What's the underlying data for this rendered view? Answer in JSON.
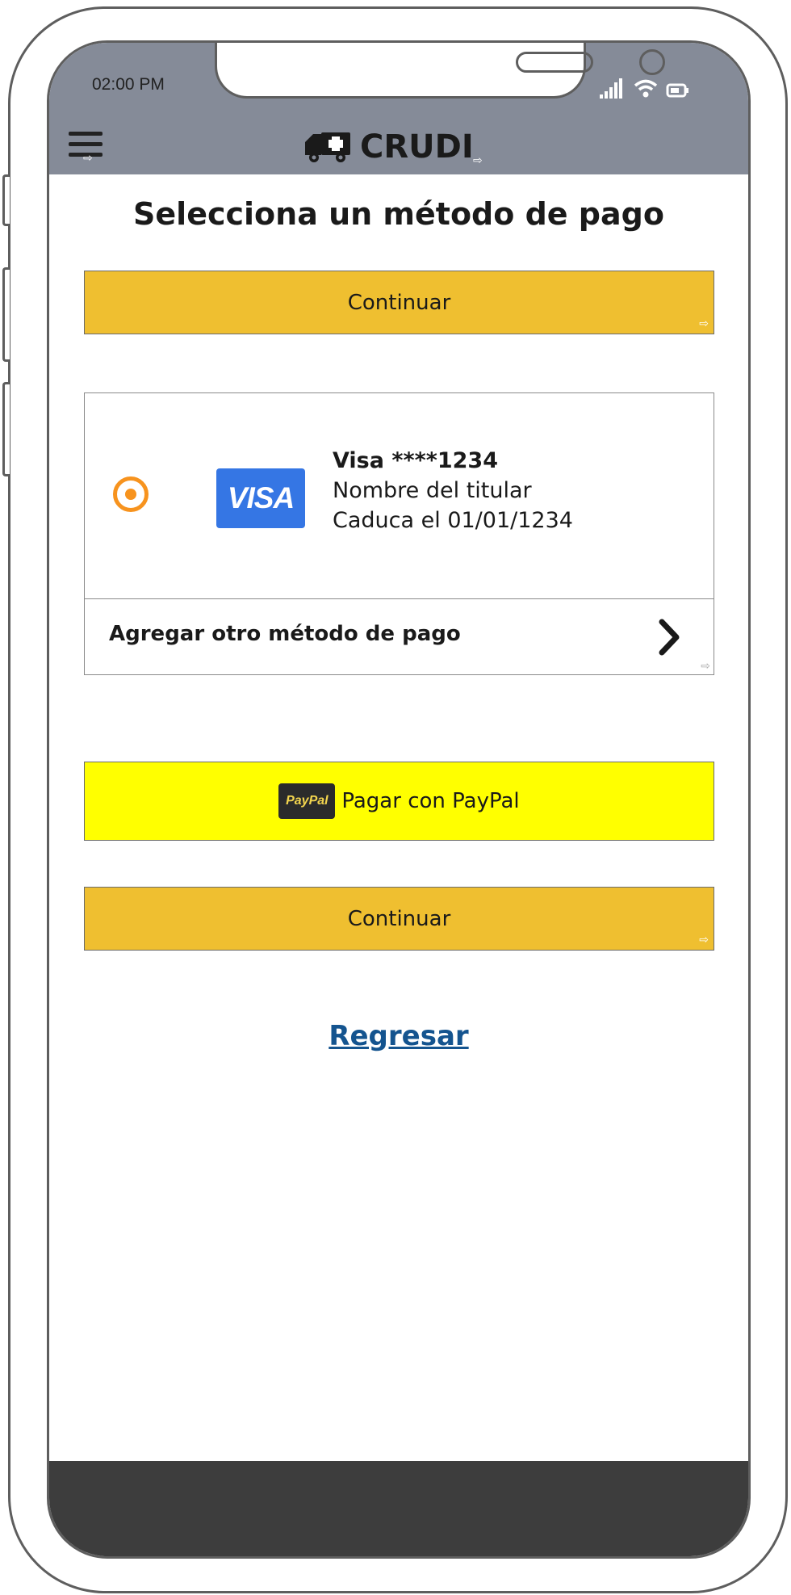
{
  "status_bar": {
    "time": "02:00 PM",
    "icons": [
      "signal-icon",
      "wifi-icon",
      "battery-icon"
    ]
  },
  "header": {
    "menu_icon": "menu-icon",
    "brand_icon": "ambulance-icon",
    "brand_name": "CRUDI"
  },
  "page": {
    "title": "Selecciona un método de pago"
  },
  "actions": {
    "continue_top_label": "Continuar",
    "continue_bottom_label": "Continuar",
    "paypal_label": "Pagar con PayPal",
    "paypal_badge": "PayPal",
    "back_label": "Regresar"
  },
  "payment_methods": {
    "selected_card": {
      "brand_logo": "VISA",
      "name": "Visa ****1234",
      "holder": "Nombre del titular",
      "expiry": "Caduca el 01/01/1234",
      "selected": true
    },
    "add_method_label": "Agregar otro método de pago"
  },
  "colors": {
    "header_bg": "#858b98",
    "primary_button": "#efbf30",
    "paypal_button": "#ffff00",
    "radio_accent": "#f7931e",
    "visa_blue": "#3576e4",
    "link": "#14548f",
    "footer_bg": "#3d3d3d"
  }
}
